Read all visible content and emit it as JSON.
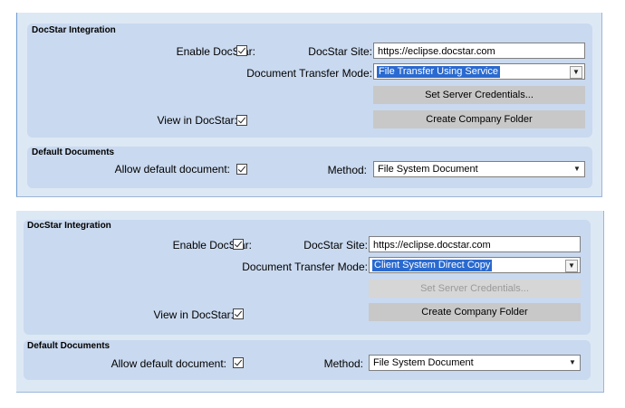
{
  "panels": [
    {
      "docstar": {
        "title": "DocStar Integration",
        "enable_label": "Enable DocStar:",
        "site_label": "DocStar Site:",
        "site_value": "https://eclipse.docstar.com",
        "transfer_label": "Document Transfer Mode:",
        "transfer_value": "File Transfer Using Service",
        "credentials_button": "Set Server Credentials...",
        "credentials_enabled": true,
        "view_label": "View in DocStar:",
        "company_folder_button": "Create Company Folder"
      },
      "defaults": {
        "title": "Default Documents",
        "allow_label": "Allow default document:",
        "method_label": "Method:",
        "method_value": "File System Document"
      }
    },
    {
      "docstar": {
        "title": "DocStar Integration",
        "enable_label": "Enable DocStar:",
        "site_label": "DocStar Site:",
        "site_value": "https://eclipse.docstar.com",
        "transfer_label": "Document Transfer Mode:",
        "transfer_value": "Client System Direct Copy",
        "credentials_button": "Set Server Credentials...",
        "credentials_enabled": false,
        "view_label": "View in DocStar:",
        "company_folder_button": "Create Company Folder"
      },
      "defaults": {
        "title": "Default Documents",
        "allow_label": "Allow default document:",
        "method_label": "Method:",
        "method_value": "File System Document"
      }
    }
  ]
}
